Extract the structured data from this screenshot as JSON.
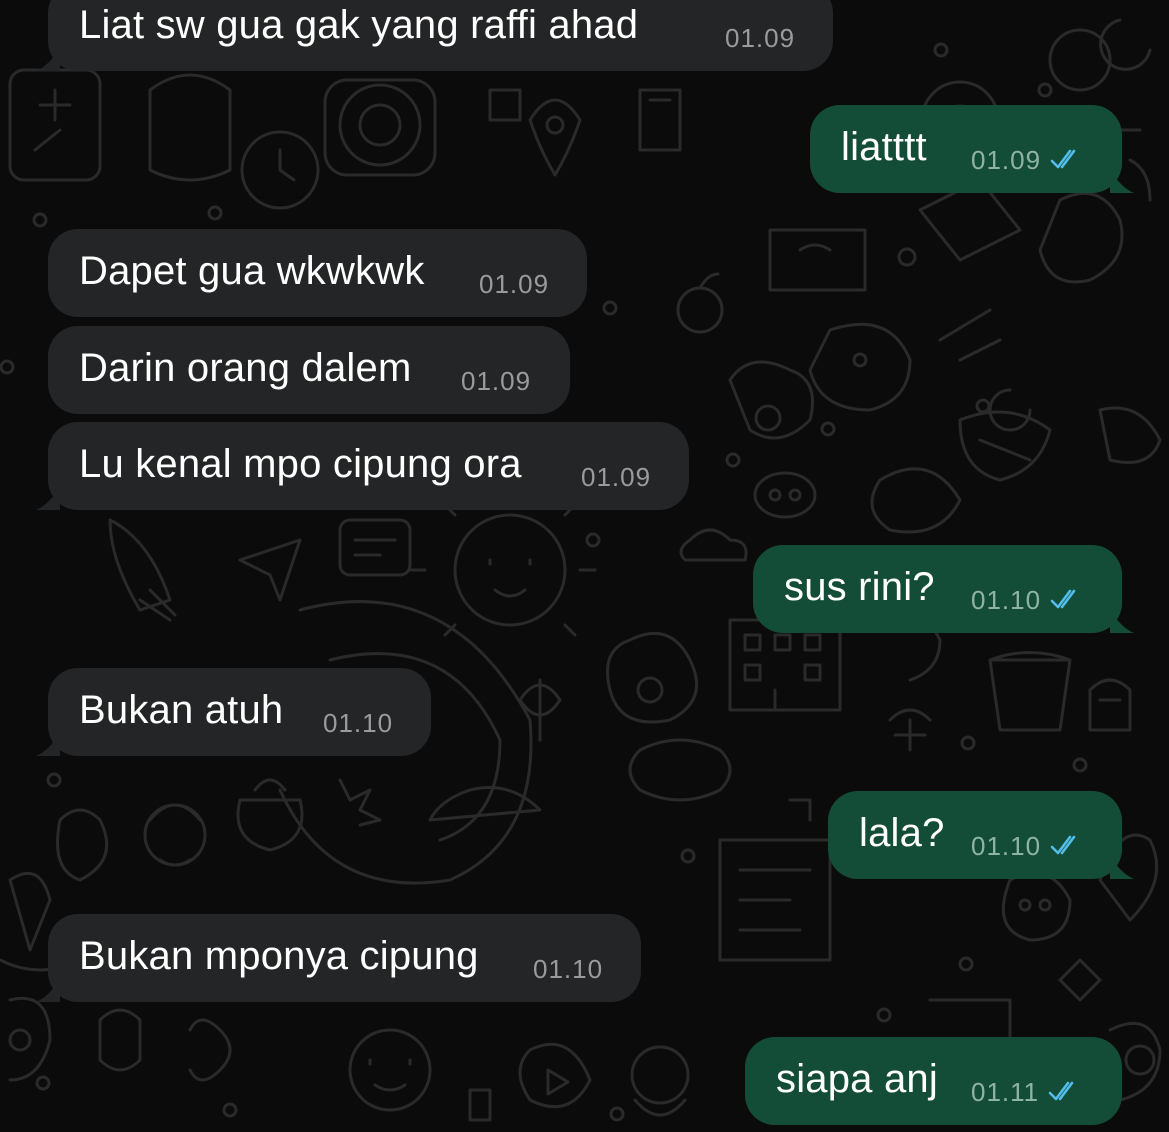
{
  "colors": {
    "background": "#0b0b0b",
    "incoming_bubble": "#242526",
    "outgoing_bubble": "#144d37",
    "read_ticks": "#53bdeb"
  },
  "messages": [
    {
      "direction": "incoming",
      "text": "Liat sw gua gak yang  raffi ahad",
      "time": "01.09"
    },
    {
      "direction": "outgoing",
      "text": "liatttt",
      "time": "01.09",
      "status": "read-double-check-icon"
    },
    {
      "direction": "incoming",
      "text": "Dapet gua wkwkwk",
      "time": "01.09"
    },
    {
      "direction": "incoming",
      "text": "Darin orang dalem",
      "time": "01.09"
    },
    {
      "direction": "incoming",
      "text": "Lu kenal mpo cipung ora",
      "time": "01.09"
    },
    {
      "direction": "outgoing",
      "text": "sus rini?",
      "time": "01.10",
      "status": "read-double-check-icon"
    },
    {
      "direction": "incoming",
      "text": "Bukan atuh",
      "time": "01.10"
    },
    {
      "direction": "outgoing",
      "text": "lala?",
      "time": "01.10",
      "status": "read-double-check-icon"
    },
    {
      "direction": "incoming",
      "text": "Bukan mponya cipung",
      "time": "01.10"
    },
    {
      "direction": "outgoing",
      "text": "siapa anj",
      "time": "01.11",
      "status": "read-double-check-icon"
    }
  ]
}
